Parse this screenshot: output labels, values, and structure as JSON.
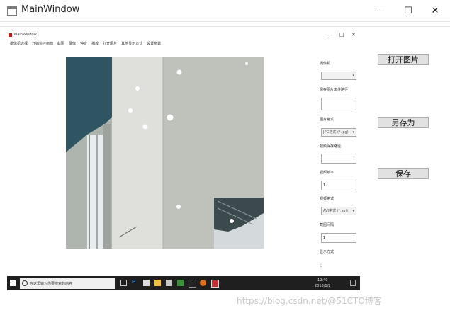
{
  "window": {
    "title": "MainWindow",
    "minimize_glyph": "—",
    "maximize_glyph": "☐",
    "close_glyph": "✕"
  },
  "inner_window": {
    "title": "MainWindow",
    "controls": [
      "—",
      "□",
      "✕"
    ],
    "menu": [
      "摄像机选择",
      "开始监控画面",
      "截图",
      "录像",
      "停止",
      "播放",
      "打开图片",
      "其他显示方式",
      "设置参数"
    ]
  },
  "settings": {
    "items": [
      {
        "label": "摄像机",
        "type": "combo",
        "value": ""
      },
      {
        "label": "保存图片文件路径",
        "type": "field",
        "value": ""
      },
      {
        "label": "图片格式",
        "type": "combo",
        "value": "JPG格式 (*.jpg)"
      },
      {
        "label": "视频保存路径",
        "type": "field",
        "value": ""
      },
      {
        "label": "视频帧率",
        "type": "field",
        "value": "1"
      },
      {
        "label": "视频格式",
        "type": "combo",
        "value": "AVI格式 (*.avi)"
      },
      {
        "label": "截图间隔",
        "type": "field",
        "value": "1"
      },
      {
        "label": "显示方式",
        "type": "text",
        "value": ""
      },
      {
        "label": "",
        "type": "text",
        "value": "○"
      }
    ]
  },
  "buttons": {
    "open_image": "打开图片",
    "save_as": "另存为",
    "save": "保存"
  },
  "taskbar": {
    "search_placeholder": "在这里输入你要搜索的内容",
    "clock_time": "12:40",
    "clock_date": "2018/1/2"
  },
  "watermark": "https://blog.csdn.net/@51CTO博客",
  "colors": {
    "taskbar_bg": "#1f1f1f",
    "button_bg": "#e1e1e1",
    "camera_wall": "#c9ccc6",
    "curtain": "#2f5563"
  }
}
